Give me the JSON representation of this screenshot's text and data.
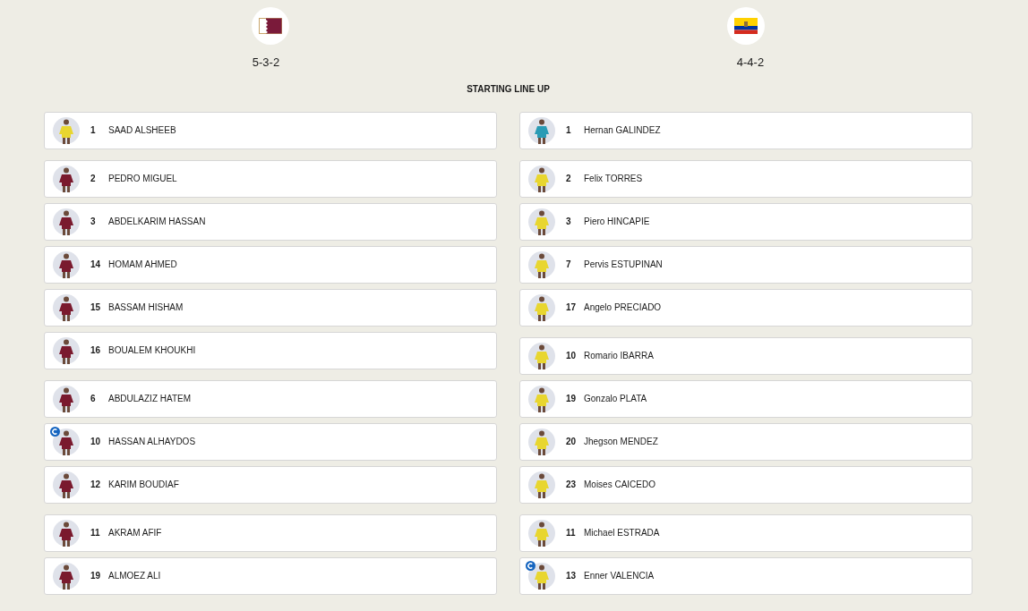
{
  "heading": "STARTING LINE UP",
  "teams": [
    {
      "kind": "qatar",
      "formation": "5-3-2",
      "lines": [
        [
          {
            "number": "1",
            "name": "SAAD ALSHEEB",
            "color": "#e8d630",
            "captain": false
          }
        ],
        [
          {
            "number": "2",
            "name": "PEDRO MIGUEL",
            "color": "#7a1a2e",
            "captain": false
          },
          {
            "number": "3",
            "name": "ABDELKARIM HASSAN",
            "color": "#7a1a2e",
            "captain": false
          },
          {
            "number": "14",
            "name": "HOMAM AHMED",
            "color": "#7a1a2e",
            "captain": false
          },
          {
            "number": "15",
            "name": "BASSAM HISHAM",
            "color": "#7a1a2e",
            "captain": false
          },
          {
            "number": "16",
            "name": "BOUALEM KHOUKHI",
            "color": "#7a1a2e",
            "captain": false
          }
        ],
        [
          {
            "number": "6",
            "name": "ABDULAZIZ HATEM",
            "color": "#7a1a2e",
            "captain": false
          },
          {
            "number": "10",
            "name": "HASSAN ALHAYDOS",
            "color": "#7a1a2e",
            "captain": true
          },
          {
            "number": "12",
            "name": "KARIM BOUDIAF",
            "color": "#7a1a2e",
            "captain": false
          }
        ],
        [
          {
            "number": "11",
            "name": "AKRAM AFIF",
            "color": "#7a1a2e",
            "captain": false
          },
          {
            "number": "19",
            "name": "ALMOEZ ALI",
            "color": "#7a1a2e",
            "captain": false
          }
        ]
      ]
    },
    {
      "kind": "ecuador",
      "formation": "4-4-2",
      "lines": [
        [
          {
            "number": "1",
            "name": "Hernan GALINDEZ",
            "color": "#2a9bb5",
            "captain": false
          }
        ],
        [
          {
            "number": "2",
            "name": "Felix TORRES",
            "color": "#e8d630",
            "captain": false
          },
          {
            "number": "3",
            "name": "Piero HINCAPIE",
            "color": "#e8d630",
            "captain": false
          },
          {
            "number": "7",
            "name": "Pervis ESTUPINAN",
            "color": "#e8d630",
            "captain": false
          },
          {
            "number": "17",
            "name": "Angelo PRECIADO",
            "color": "#e8d630",
            "captain": false
          }
        ],
        [
          {
            "number": "10",
            "name": "Romario IBARRA",
            "color": "#e8d630",
            "captain": false
          },
          {
            "number": "19",
            "name": "Gonzalo PLATA",
            "color": "#e8d630",
            "captain": false
          },
          {
            "number": "20",
            "name": "Jhegson MENDEZ",
            "color": "#e8d630",
            "captain": false
          },
          {
            "number": "23",
            "name": "Moises CAICEDO",
            "color": "#e8d630",
            "captain": false
          }
        ],
        [
          {
            "number": "11",
            "name": "Michael ESTRADA",
            "color": "#e8d630",
            "captain": false
          },
          {
            "number": "13",
            "name": "Enner VALENCIA",
            "color": "#e8d630",
            "captain": true
          }
        ]
      ]
    }
  ]
}
